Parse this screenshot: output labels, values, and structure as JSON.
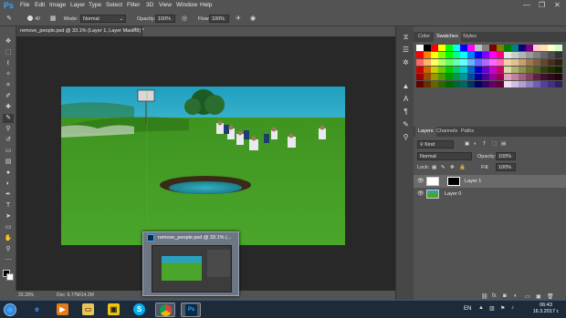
{
  "app": {
    "name": "Ps"
  },
  "menu": [
    "File",
    "Edit",
    "Image",
    "Layer",
    "Type",
    "Select",
    "Filter",
    "3D",
    "View",
    "Window",
    "Help"
  ],
  "window_controls": {
    "minimize": "—",
    "restore": "❐",
    "close": "✕"
  },
  "options": {
    "brush_size": "40",
    "mode_label": "Mode:",
    "mode_value": "Normal",
    "opacity_label": "Opacity:",
    "opacity_value": "100%",
    "flow_label": "Flow:",
    "flow_value": "100%"
  },
  "document": {
    "tab_title": "remove_people.psd @ 33.1% (Layer 1, Layer Mask/8) *",
    "tab_close": "×",
    "zoom": "33.33%",
    "doc_info": "Doc: 6.77M/14.2M"
  },
  "thumbnail": {
    "title": "remove_people.psd @ 33.1% (..."
  },
  "panels": {
    "top_tabs": [
      "Color",
      "Swatches",
      "Styles"
    ],
    "layer_tabs": [
      "Layers",
      "Channels",
      "Paths"
    ],
    "kind_label": "Kind",
    "blend_mode": "Normal",
    "opacity_label": "Opacity:",
    "opacity_value": "100%",
    "lock_label": "Lock:",
    "fill_label": "Fill:",
    "fill_value": "100%",
    "layers": [
      {
        "name": "Layer 1",
        "visible": true,
        "selected": true,
        "has_mask": true
      },
      {
        "name": "Layer 0",
        "visible": true,
        "selected": false,
        "has_mask": false
      }
    ],
    "swatch_colors": [
      "#ffffff",
      "#000000",
      "#ff0000",
      "#ffff00",
      "#00ff00",
      "#00ffff",
      "#0000ff",
      "#ff00ff",
      "#c0c0c0",
      "#808080",
      "#800000",
      "#808000",
      "#008000",
      "#008080",
      "#000080",
      "#800080",
      "#ffcccc",
      "#ffe0b0",
      "#ffffcc",
      "#ccffcc",
      "#ff0000",
      "#ff8000",
      "#ffff00",
      "#80ff00",
      "#00ff00",
      "#00ff80",
      "#00ffff",
      "#0080ff",
      "#0000ff",
      "#8000ff",
      "#ff00ff",
      "#ff0080",
      "#e6e6e6",
      "#cccccc",
      "#b3b3b3",
      "#999999",
      "#808080",
      "#666666",
      "#4d4d4d",
      "#333333",
      "#ff6666",
      "#ffb366",
      "#ffff66",
      "#b3ff66",
      "#66ff66",
      "#66ffb3",
      "#66ffff",
      "#66b3ff",
      "#6666ff",
      "#b366ff",
      "#ff66ff",
      "#ff66b3",
      "#f2d0a0",
      "#e0c090",
      "#c8a070",
      "#a07850",
      "#806040",
      "#604830",
      "#483020",
      "#302010",
      "#cc0000",
      "#cc6600",
      "#cccc00",
      "#66cc00",
      "#00cc00",
      "#00cc66",
      "#00cccc",
      "#0066cc",
      "#0000cc",
      "#6600cc",
      "#cc00cc",
      "#cc0066",
      "#d9d9a0",
      "#b0b070",
      "#909050",
      "#707030",
      "#506020",
      "#304010",
      "#203000",
      "#102000",
      "#990000",
      "#994c00",
      "#999900",
      "#4c9900",
      "#009900",
      "#00994c",
      "#009999",
      "#004c99",
      "#000099",
      "#4c0099",
      "#990099",
      "#99004c",
      "#e0a0c0",
      "#c080a0",
      "#a06080",
      "#804060",
      "#602040",
      "#401030",
      "#300820",
      "#200410",
      "#660000",
      "#663300",
      "#666600",
      "#336600",
      "#006600",
      "#006633",
      "#006666",
      "#003366",
      "#000066",
      "#330066",
      "#660066",
      "#660033",
      "#f0e0f0",
      "#d0c0e0",
      "#b0a0d0",
      "#9080c0",
      "#7060b0",
      "#5040a0",
      "#403080",
      "#302060"
    ]
  },
  "taskbar": {
    "language": "EN",
    "time": "06:43",
    "date": "16.3.2017 г."
  }
}
